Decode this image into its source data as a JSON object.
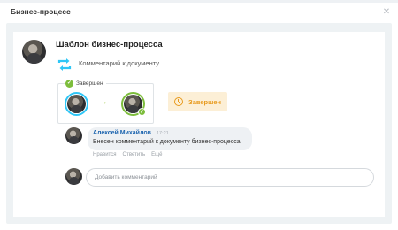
{
  "dialog": {
    "title": "Бизнес-процесс",
    "close_icon": "close-icon"
  },
  "process": {
    "title": "Шаблон бизнес-процесса",
    "task_icon": "refresh-icon",
    "task_label": "Комментарий к документу"
  },
  "workflow": {
    "label": "Завершен",
    "arrow": "→",
    "check": "✓",
    "status_label": "Завершен",
    "status_icon": "clock-icon"
  },
  "comment": {
    "author": "Алексей Михайлов",
    "time": "17:21",
    "text": "Внесен комментарий к документу бизнес-процесса!",
    "actions": [
      "Нравится",
      "Ответить",
      "Ещё"
    ]
  },
  "new_comment": {
    "placeholder": "Добавить комментарий"
  },
  "colors": {
    "accent_blue": "#2fc6f6",
    "success_green": "#7dbd3c",
    "status_orange": "#e89b1f",
    "author_blue": "#2067b0"
  }
}
